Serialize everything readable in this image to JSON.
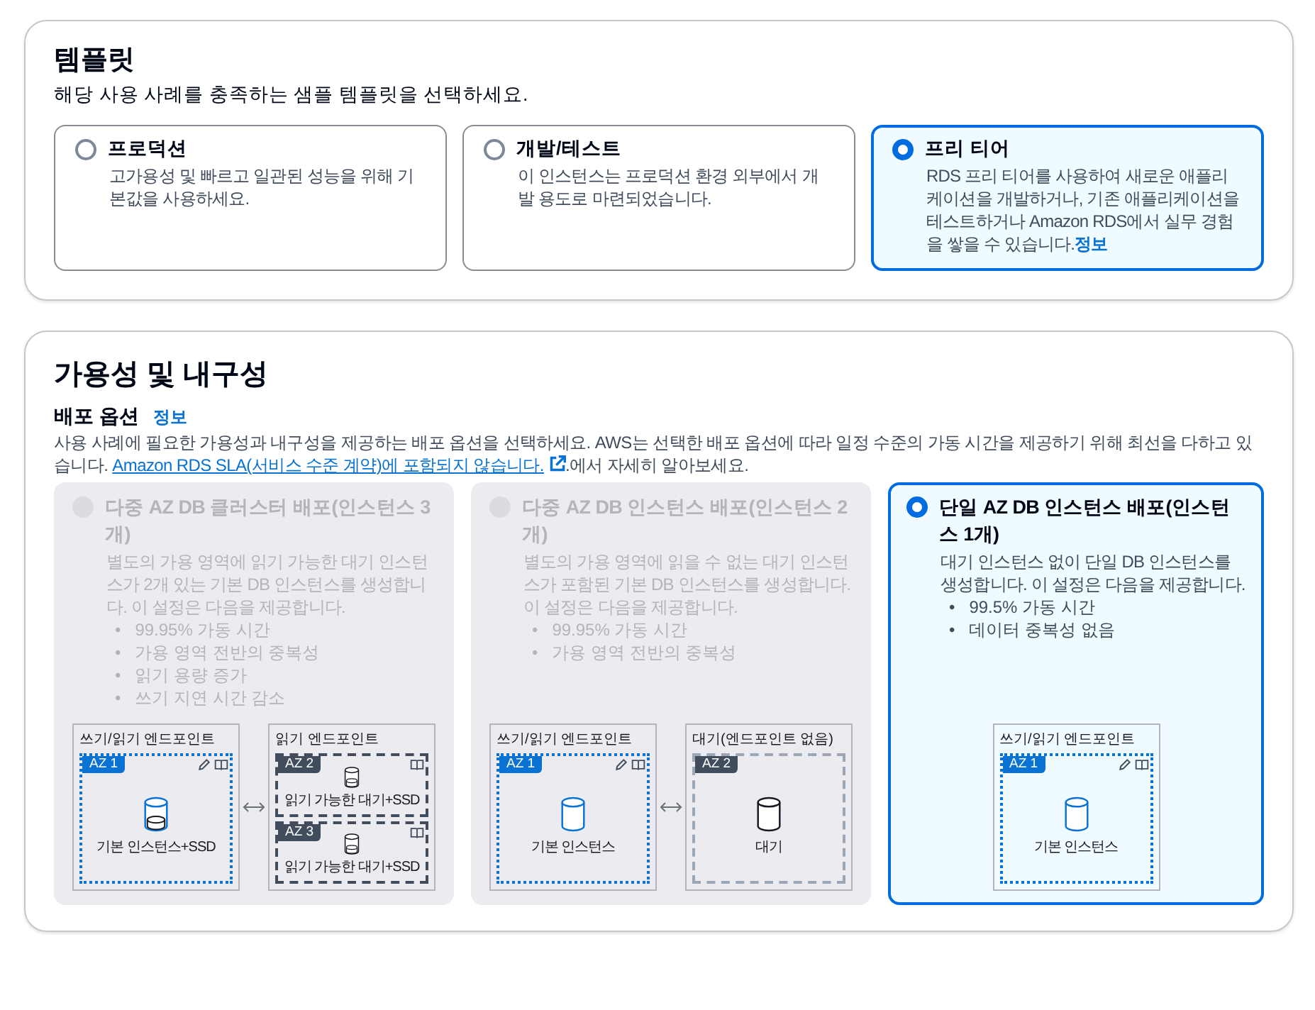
{
  "template": {
    "title": "템플릿",
    "subtitle": "해당 사용 사례를 충족하는 샘플 템플릿을 선택하세요.",
    "options": [
      {
        "label": "프로덕션",
        "description": "고가용성 및 빠르고 일관된 성능을 위해 기본값을 사용하세요.",
        "selected": false
      },
      {
        "label": "개발/테스트",
        "description": "이 인스턴스는 프로덕션 환경 외부에서 개발 용도로 마련되었습니다.",
        "selected": false
      },
      {
        "label": "프리 티어",
        "description": "RDS 프리 티어를 사용하여 새로운 애플리케이션을 개발하거나, 기존 애플리케이션을 테스트하거나 Amazon RDS에서 실무 경험을 쌓을 수 있습니다.",
        "info_link": "정보",
        "selected": true
      }
    ]
  },
  "availability": {
    "title": "가용성 및 내구성",
    "field_label": "배포 옵션",
    "info_link": "정보",
    "description": "사용 사례에 필요한 가용성과 내구성을 제공하는 배포 옵션을 선택하세요. AWS는 선택한 배포 옵션에 따라 일정 수준의 가동 시간을 제공하기 위해 최선을 다하고 있습니다.",
    "bullet_marker": "•",
    "sla_link": "Amazon RDS SLA(서비스 수준 계약)에 포함되지 않습니다.",
    "after_link": ".에서 자세히 알아보세요.",
    "options": [
      {
        "label": "다중 AZ DB 클러스터 배포(인스턴스 3개)",
        "description": "별도의 가용 영역에 읽기 가능한 대기 인스턴스가 2개 있는 기본 DB 인스턴스를 생성합니다. 이 설정은 다음을 제공합니다.",
        "bullets": [
          "99.95% 가동 시간",
          "가용 영역 전반의 중복성",
          "읽기 용량 증가",
          "쓰기 지연 시간 감소"
        ],
        "selected": false,
        "disabled": true,
        "diagram": [
          {
            "title": "쓰기/읽기 엔드포인트",
            "zones": [
              {
                "az": "AZ 1",
                "kind": "primary",
                "ssd": true,
                "caption": "기본 인스턴스+SSD"
              }
            ]
          },
          {
            "title": "읽기 엔드포인트",
            "zones": [
              {
                "az": "AZ 2",
                "kind": "readable",
                "ssd": true,
                "caption": "읽기 가능한 대기+SSD"
              },
              {
                "az": "AZ 3",
                "kind": "readable",
                "ssd": true,
                "caption": "읽기 가능한 대기+SSD"
              }
            ]
          }
        ]
      },
      {
        "label": "다중 AZ DB 인스턴스 배포(인스턴스 2개)",
        "description": "별도의 가용 영역에 읽을 수 없는 대기 인스턴스가 포함된 기본 DB 인스턴스를 생성합니다. 이 설정은 다음을 제공합니다.",
        "bullets": [
          "99.95% 가동 시간",
          "가용 영역 전반의 중복성"
        ],
        "selected": false,
        "disabled": true,
        "diagram": [
          {
            "title": "쓰기/읽기 엔드포인트",
            "zones": [
              {
                "az": "AZ 1",
                "kind": "primary",
                "ssd": false,
                "caption": "기본 인스턴스"
              }
            ]
          },
          {
            "title": "대기(엔드포인트 없음)",
            "zones": [
              {
                "az": "AZ 2",
                "kind": "standby",
                "ssd": false,
                "caption": "대기"
              }
            ]
          }
        ]
      },
      {
        "label": "단일 AZ DB 인스턴스 배포(인스턴스 1개)",
        "description": "대기 인스턴스 없이 단일 DB 인스턴스를 생성합니다. 이 설정은 다음을 제공합니다.",
        "bullets": [
          "99.5% 가동 시간",
          "데이터 중복성 없음"
        ],
        "selected": true,
        "disabled": false,
        "diagram": [
          {
            "title": "쓰기/읽기 엔드포인트",
            "zones": [
              {
                "az": "AZ 1",
                "kind": "primary",
                "ssd": false,
                "caption": "기본 인스턴스"
              }
            ]
          }
        ]
      }
    ]
  }
}
